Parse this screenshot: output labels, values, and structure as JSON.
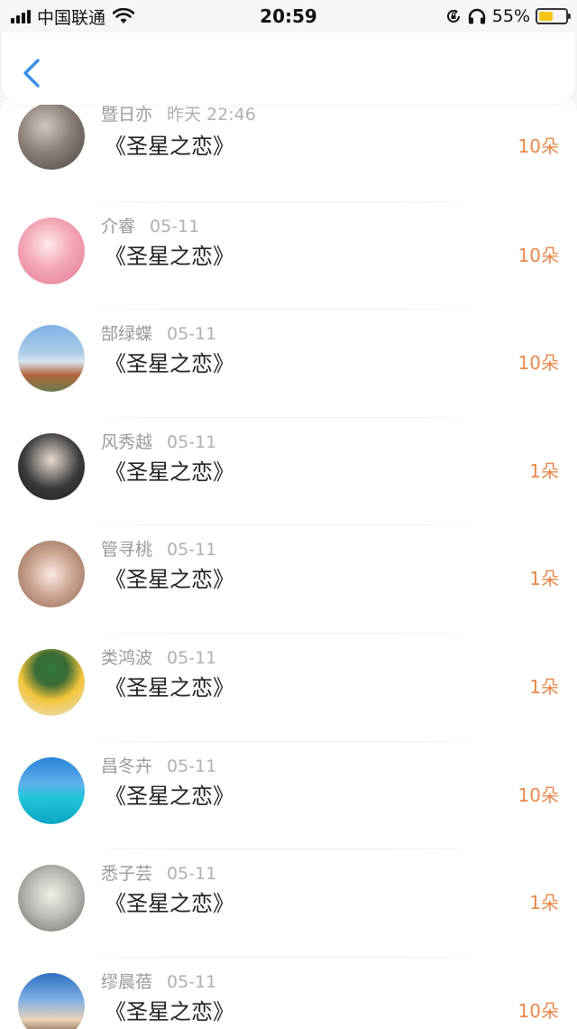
{
  "status_bar": {
    "carrier": "中国联通",
    "time": "20:59",
    "battery_percent": "55%",
    "battery_level": 0.55,
    "battery_color": "#f5c518",
    "icons": [
      "signal-icon",
      "wifi-icon",
      "rotation-lock-icon",
      "headphone-icon",
      "battery-icon"
    ]
  },
  "header": {
    "back_icon": "chevron-left-icon",
    "accent": "#3a8ee6"
  },
  "colors": {
    "count": "#e8884a",
    "name": "#9a9a9a",
    "gift": "#222222"
  },
  "records": [
    {
      "name": "暨日亦",
      "date": "昨天 22:46",
      "gift": "《圣星之恋》",
      "count": "10朵"
    },
    {
      "name": "介睿",
      "date": "05-11",
      "gift": "《圣星之恋》",
      "count": "10朵"
    },
    {
      "name": "郜绿蝶",
      "date": "05-11",
      "gift": "《圣星之恋》",
      "count": "10朵"
    },
    {
      "name": "风秀越",
      "date": "05-11",
      "gift": "《圣星之恋》",
      "count": "1朵"
    },
    {
      "name": "管寻桃",
      "date": "05-11",
      "gift": "《圣星之恋》",
      "count": "1朵"
    },
    {
      "name": "类鸿波",
      "date": "05-11",
      "gift": "《圣星之恋》",
      "count": "1朵"
    },
    {
      "name": "昌冬卉",
      "date": "05-11",
      "gift": "《圣星之恋》",
      "count": "10朵"
    },
    {
      "name": "悉子芸",
      "date": "05-11",
      "gift": "《圣星之恋》",
      "count": "1朵"
    },
    {
      "name": "缪晨蓓",
      "date": "05-11",
      "gift": "《圣星之恋》",
      "count": "10朵"
    }
  ]
}
